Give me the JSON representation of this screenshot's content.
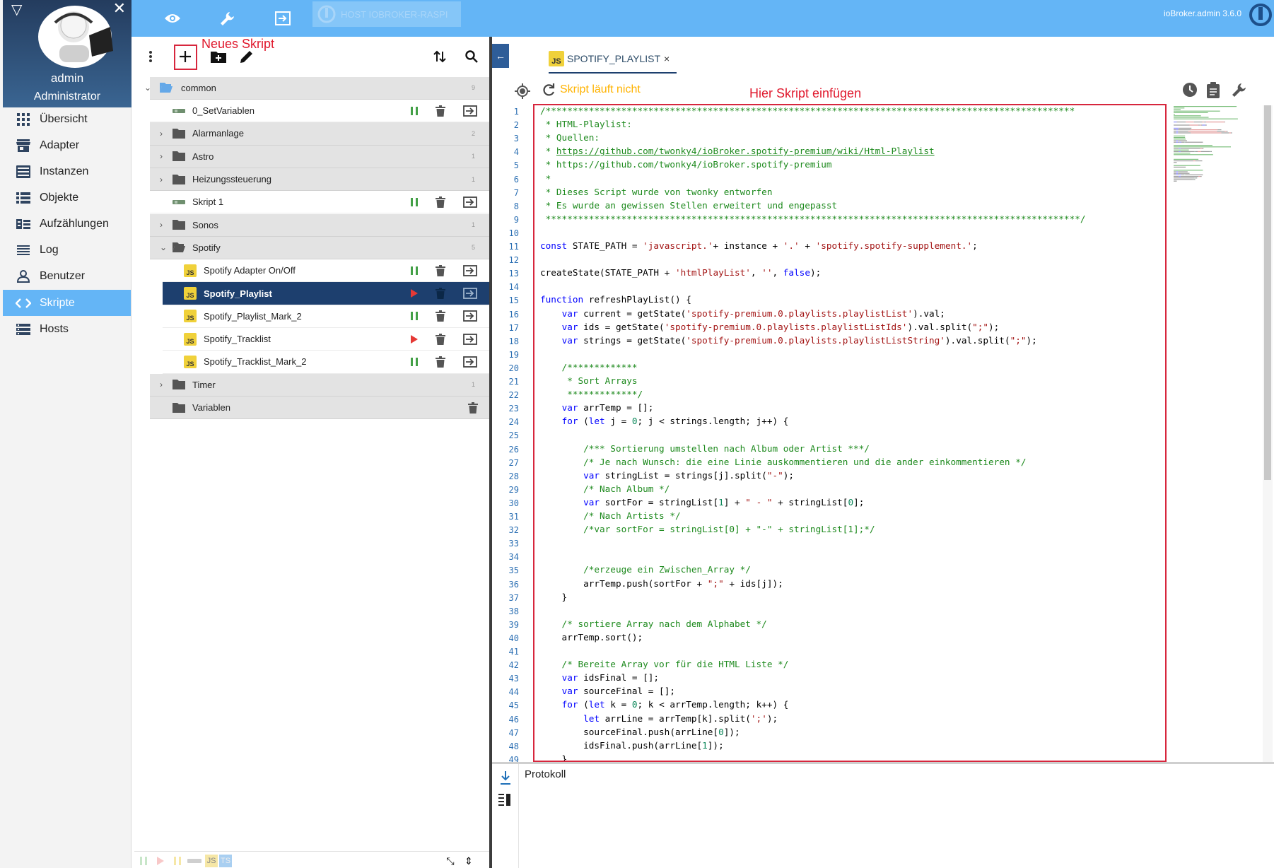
{
  "user": {
    "name": "admin",
    "role": "Administrator"
  },
  "nav": [
    {
      "label": "Übersicht",
      "icon": "grid-icon"
    },
    {
      "label": "Adapter",
      "icon": "store-icon"
    },
    {
      "label": "Instanzen",
      "icon": "instances-icon"
    },
    {
      "label": "Objekte",
      "icon": "list-icon"
    },
    {
      "label": "Aufzählungen",
      "icon": "enum-icon"
    },
    {
      "label": "Log",
      "icon": "log-icon"
    },
    {
      "label": "Benutzer",
      "icon": "user-icon"
    },
    {
      "label": "Skripte",
      "icon": "code-icon"
    },
    {
      "label": "Hosts",
      "icon": "hosts-icon"
    }
  ],
  "topbar": {
    "host_label": "HOST IOBROKER-RASPI",
    "version": "ioBroker.admin 3.6.0"
  },
  "annotations": {
    "new_script": "Neues Skript",
    "insert_here": "Hier Skript einfügen"
  },
  "tree": {
    "root": {
      "label": "common",
      "count": "9"
    },
    "rows": [
      {
        "type": "script",
        "label": "0_SetVariablen",
        "kind": "blockly",
        "state": "paused"
      },
      {
        "type": "folder",
        "label": "Alarmanlage",
        "count": "2"
      },
      {
        "type": "folder",
        "label": "Astro",
        "count": "1"
      },
      {
        "type": "folder",
        "label": "Heizungssteuerung",
        "count": "1"
      },
      {
        "type": "script",
        "label": "Skript 1",
        "kind": "blockly",
        "state": "paused"
      },
      {
        "type": "folder",
        "label": "Sonos",
        "count": "1"
      },
      {
        "type": "folder-open",
        "label": "Spotify",
        "count": "5"
      },
      {
        "type": "child",
        "label": "Spotify Adapter On/Off",
        "kind": "js",
        "state": "paused"
      },
      {
        "type": "child-selected",
        "label": "Spotify_Playlist",
        "kind": "js",
        "state": "stopped"
      },
      {
        "type": "child",
        "label": "Spotify_Playlist_Mark_2",
        "kind": "js",
        "state": "paused"
      },
      {
        "type": "child",
        "label": "Spotify_Tracklist",
        "kind": "js",
        "state": "stopped"
      },
      {
        "type": "child",
        "label": "Spotify_Tracklist_Mark_2",
        "kind": "js",
        "state": "paused"
      },
      {
        "type": "folder",
        "label": "Timer",
        "count": "1"
      },
      {
        "type": "folder-empty",
        "label": "Variablen",
        "count": ""
      }
    ]
  },
  "footer": {
    "js": "JS",
    "ts": "TS"
  },
  "editor": {
    "tab_label": "SPOTIFY_PLAYLIST",
    "tab_close": "×",
    "status": "Skript läuft nicht",
    "log_title": "Protokoll"
  },
  "code": [
    [
      [
        "c",
        "/**************************************************************************************************"
      ]
    ],
    [
      [
        "c",
        " * HTML-Playlist:"
      ]
    ],
    [
      [
        "c",
        " * Quellen:"
      ]
    ],
    [
      [
        "c",
        " * "
      ],
      [
        "l",
        "https://github.com/twonky4/ioBroker.spotify-premium/wiki/Html-Playlist"
      ]
    ],
    [
      [
        "c",
        " * https://github.com/twonky4/ioBroker.spotify-premium"
      ]
    ],
    [
      [
        "c",
        " *"
      ]
    ],
    [
      [
        "c",
        " * Dieses Script wurde von twonky entworfen"
      ]
    ],
    [
      [
        "c",
        " * Es wurde an gewissen Stellen erweitert und engepasst"
      ]
    ],
    [
      [
        "c",
        " ***************************************************************************************************/"
      ]
    ],
    [],
    [
      [
        "k",
        "const"
      ],
      [
        "p",
        " STATE_PATH = "
      ],
      [
        "s",
        "'javascript.'"
      ],
      [
        "p",
        "+ instance + "
      ],
      [
        "s",
        "'.'"
      ],
      [
        "p",
        " + "
      ],
      [
        "s",
        "'spotify.spotify-supplement.'"
      ],
      [
        "p",
        ";"
      ]
    ],
    [],
    [
      [
        "p",
        "createState(STATE_PATH + "
      ],
      [
        "s",
        "'htmlPlayList'"
      ],
      [
        "p",
        ", "
      ],
      [
        "s",
        "''"
      ],
      [
        "p",
        ", "
      ],
      [
        "k",
        "false"
      ],
      [
        "p",
        ");"
      ]
    ],
    [],
    [
      [
        "k",
        "function"
      ],
      [
        "p",
        " refreshPlayList() {"
      ]
    ],
    [
      [
        "p",
        "    "
      ],
      [
        "k",
        "var"
      ],
      [
        "p",
        " current = getState("
      ],
      [
        "s",
        "'spotify-premium.0.playlists.playlistList'"
      ],
      [
        "p",
        ").val;"
      ]
    ],
    [
      [
        "p",
        "    "
      ],
      [
        "k",
        "var"
      ],
      [
        "p",
        " ids = getState("
      ],
      [
        "s",
        "'spotify-premium.0.playlists.playlistListIds'"
      ],
      [
        "p",
        ").val.split("
      ],
      [
        "s",
        "\";\""
      ],
      [
        "p",
        ");"
      ]
    ],
    [
      [
        "p",
        "    "
      ],
      [
        "k",
        "var"
      ],
      [
        "p",
        " strings = getState("
      ],
      [
        "s",
        "'spotify-premium.0.playlists.playlistListString'"
      ],
      [
        "p",
        ").val.split("
      ],
      [
        "s",
        "\";\""
      ],
      [
        "p",
        ");"
      ]
    ],
    [],
    [
      [
        "c",
        "    /*************"
      ]
    ],
    [
      [
        "c",
        "     * Sort Arrays"
      ]
    ],
    [
      [
        "c",
        "     *************/"
      ]
    ],
    [
      [
        "p",
        "    "
      ],
      [
        "k",
        "var"
      ],
      [
        "p",
        " arrTemp = [];"
      ]
    ],
    [
      [
        "p",
        "    "
      ],
      [
        "k",
        "for"
      ],
      [
        "p",
        " ("
      ],
      [
        "k",
        "let"
      ],
      [
        "p",
        " j = "
      ],
      [
        "n",
        "0"
      ],
      [
        "p",
        "; j < strings.length; j++) {"
      ]
    ],
    [],
    [
      [
        "c",
        "        /*** Sortierung umstellen nach Album oder Artist ***/"
      ]
    ],
    [
      [
        "c",
        "        /* Je nach Wunsch: die eine Linie auskommentieren und die ander einkommentieren */"
      ]
    ],
    [
      [
        "p",
        "        "
      ],
      [
        "k",
        "var"
      ],
      [
        "p",
        " stringList = strings[j].split("
      ],
      [
        "s",
        "\"-\""
      ],
      [
        "p",
        ");"
      ]
    ],
    [
      [
        "c",
        "        /* Nach Album */"
      ]
    ],
    [
      [
        "p",
        "        "
      ],
      [
        "k",
        "var"
      ],
      [
        "p",
        " sortFor = stringList["
      ],
      [
        "n",
        "1"
      ],
      [
        "p",
        "] + "
      ],
      [
        "s",
        "\" - \""
      ],
      [
        "p",
        " + stringList["
      ],
      [
        "n",
        "0"
      ],
      [
        "p",
        "];"
      ]
    ],
    [
      [
        "c",
        "        /* Nach Artists */"
      ]
    ],
    [
      [
        "c",
        "        /*var sortFor = stringList[0] + \"-\" + stringList[1];*/"
      ]
    ],
    [],
    [],
    [
      [
        "c",
        "        /*erzeuge ein Zwischen_Array */"
      ]
    ],
    [
      [
        "p",
        "        arrTemp.push(sortFor + "
      ],
      [
        "s",
        "\";\""
      ],
      [
        "p",
        " + ids[j]);"
      ]
    ],
    [
      [
        "p",
        "    }"
      ]
    ],
    [],
    [
      [
        "c",
        "    /* sortiere Array nach dem Alphabet */"
      ]
    ],
    [
      [
        "p",
        "    arrTemp.sort();"
      ]
    ],
    [],
    [
      [
        "c",
        "    /* Bereite Array vor für die HTML Liste */"
      ]
    ],
    [
      [
        "p",
        "    "
      ],
      [
        "k",
        "var"
      ],
      [
        "p",
        " idsFinal = [];"
      ]
    ],
    [
      [
        "p",
        "    "
      ],
      [
        "k",
        "var"
      ],
      [
        "p",
        " sourceFinal = [];"
      ]
    ],
    [
      [
        "p",
        "    "
      ],
      [
        "k",
        "for"
      ],
      [
        "p",
        " ("
      ],
      [
        "k",
        "let"
      ],
      [
        "p",
        " k = "
      ],
      [
        "n",
        "0"
      ],
      [
        "p",
        "; k < arrTemp.length; k++) {"
      ]
    ],
    [
      [
        "p",
        "        "
      ],
      [
        "k",
        "let"
      ],
      [
        "p",
        " arrLine = arrTemp[k].split("
      ],
      [
        "s",
        "';'"
      ],
      [
        "p",
        ");"
      ]
    ],
    [
      [
        "p",
        "        sourceFinal.push(arrLine["
      ],
      [
        "n",
        "0"
      ],
      [
        "p",
        "]);"
      ]
    ],
    [
      [
        "p",
        "        idsFinal.push(arrLine["
      ],
      [
        "n",
        "1"
      ],
      [
        "p",
        "]);"
      ]
    ],
    [
      [
        "p",
        "    }"
      ]
    ]
  ]
}
